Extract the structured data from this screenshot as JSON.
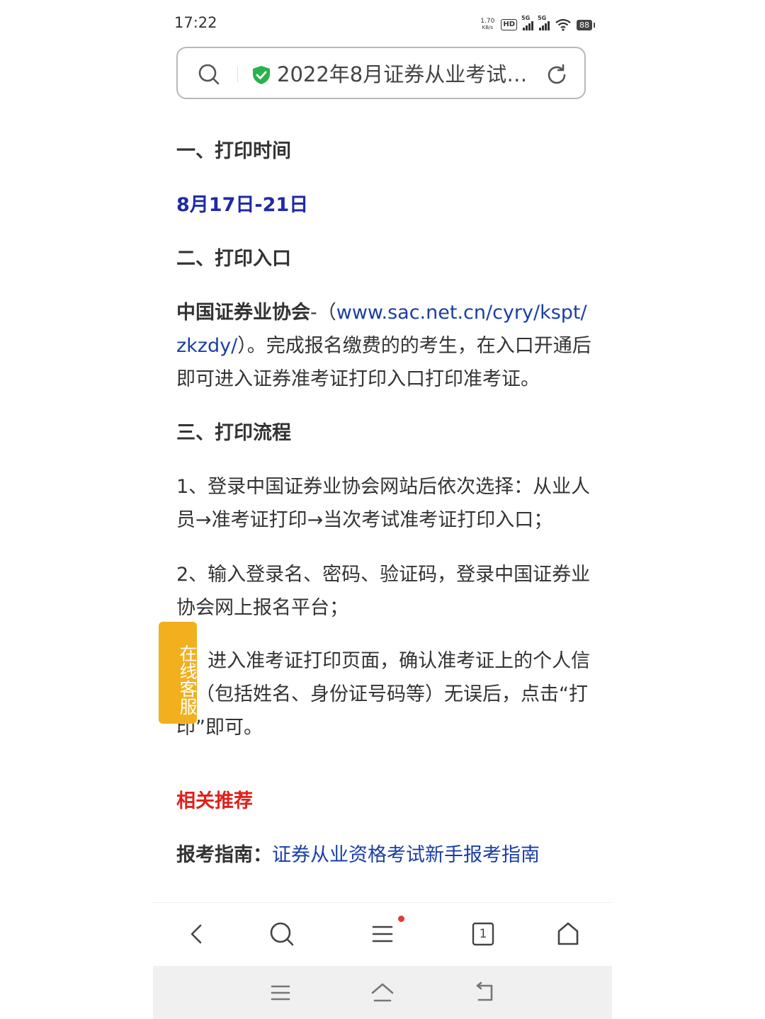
{
  "status_bar": {
    "time": "17:22",
    "net_speed_value": "1.70",
    "net_speed_unit": "KB/s",
    "hd_label": "HD",
    "signal1_label": "5G",
    "signal2_label": "5G",
    "battery": "88"
  },
  "address_bar": {
    "page_title": "2022年8月证券从业考试…"
  },
  "article": {
    "section1_heading": "一、打印时间",
    "print_date": "8月17日-21日",
    "section2_heading": "二、打印入口",
    "entry_org": "中国证券业协会",
    "entry_dash": "-（",
    "entry_url": "www.sac.net.cn/cyry/kspt/zkzdy/",
    "entry_text": "）。完成报名缴费的的考生，在入口开通后即可进入证券准考证打印入口打印准考证。",
    "section3_heading": "三、打印流程",
    "step1": "1、登录中国证券业协会网站后依次选择：从业人员→准考证打印→当次考试准考证打印入口；",
    "step2": "2、输入登录名、密码、验证码，登录中国证券业协会网上报名平台；",
    "step3": "3、进入准考证打印页面，确认准考证上的个人信息（包括姓名、身份证号码等）无误后，点击“打印”即可。",
    "related_heading": "相关推荐",
    "guide_label": "报考指南：",
    "guide_link": "证券从业资格考试新手报考指南"
  },
  "floating_service": {
    "label": "在线客服",
    "color": "#f2b01e"
  },
  "toolbar": {
    "tab_count": "1",
    "icons": [
      "back-icon",
      "search-icon",
      "menu-icon",
      "tabs-icon",
      "home-icon"
    ]
  },
  "system_nav": {
    "icons": [
      "recents-icon",
      "home-icon",
      "back-icon"
    ]
  },
  "colors": {
    "date_blue": "#1f2aa8",
    "link_blue": "#1a3ea6",
    "red_heading": "#e0211b",
    "shield_green": "#2bb24c"
  }
}
